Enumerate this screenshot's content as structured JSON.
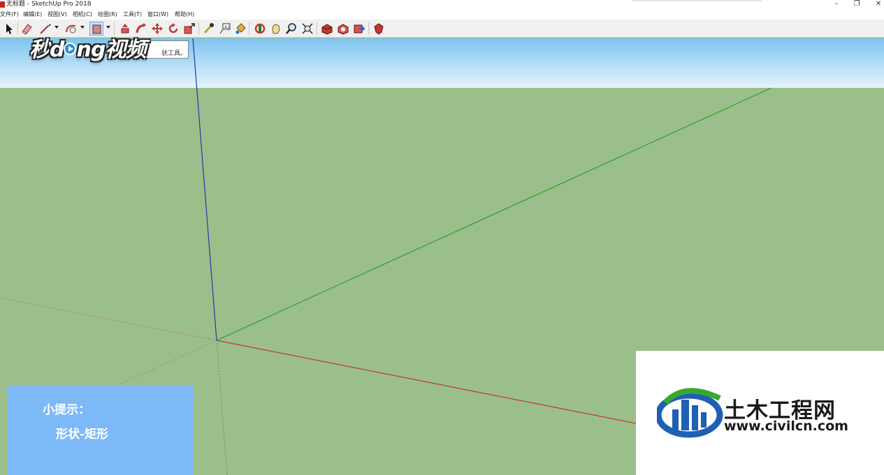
{
  "window": {
    "title": "无标题 - SketchUp Pro 2018",
    "controls": {
      "minimize": "–",
      "restore": "❐",
      "close": "✕"
    }
  },
  "menu": [
    {
      "id": "file",
      "label": "文件(F)"
    },
    {
      "id": "edit",
      "label": "编辑(E)"
    },
    {
      "id": "view",
      "label": "视图(V)"
    },
    {
      "id": "camera",
      "label": "相机(C)"
    },
    {
      "id": "draw",
      "label": "绘图(R)"
    },
    {
      "id": "tools",
      "label": "工具(T)"
    },
    {
      "id": "window",
      "label": "窗口(W)"
    },
    {
      "id": "help",
      "label": "帮助(H)"
    }
  ],
  "toolbar": {
    "tools": [
      "select-icon",
      "eraser-icon",
      "line-icon",
      "arc-icon",
      "rectangle-shape-icon",
      "push-pull-icon",
      "follow-me-icon",
      "move-icon",
      "rotate-icon",
      "scale-icon",
      "tape-measure-icon",
      "text-icon",
      "paint-bucket-icon",
      "orbit-icon",
      "pan-icon",
      "zoom-icon",
      "zoom-extents-icon",
      "3d-warehouse-icon",
      "extension-warehouse-icon",
      "send-to-layout-icon",
      "extension-manager-icon"
    ],
    "active_tool": "rectangle-shape-icon"
  },
  "tooltip": {
    "text": "状工具。"
  },
  "axes": {
    "red": "#c0392b",
    "green": "#27a32a",
    "blue": "#1f3aa8"
  },
  "watermark": {
    "brand_left": "秒",
    "brand_mid": "d",
    "brand_right": "ng视频"
  },
  "tip": {
    "title": "小提示：",
    "text": "形状-矩形"
  },
  "logo": {
    "cn": "土木工程网",
    "url": "www.civilcn.com",
    "blue": "#1f5fb4",
    "green": "#38a832"
  },
  "colors": {
    "sky_top": "#7ec3ef",
    "ground": "#9bbf8a",
    "tip_bg": "#7eb9f7"
  }
}
